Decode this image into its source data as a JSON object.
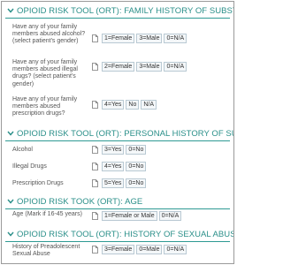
{
  "colors": {
    "accent": "#2a8f89",
    "rule": "#2e9a93",
    "option_border": "#b9c9d3",
    "option_bg": "#f4f7f9"
  },
  "icons": {
    "section_toggle": "chevron-down-icon",
    "field_notes": "document-icon"
  },
  "sections": [
    {
      "title": "OPIOID RISK TOOL (ORT): FAMILY HISTORY OF SUBSTANCE ABUSE",
      "questions": [
        {
          "text": "Have any of your family members abused alcohol? (select patient's gender)",
          "options": [
            "1=Female",
            "3=Male",
            "0=N/A"
          ]
        },
        {
          "text": "Have any of your family members abused illegal drugs? (select patient's gender)",
          "options": [
            "2=Female",
            "3=Male",
            "0=N/A"
          ]
        },
        {
          "text": "Have any of your family members abused prescription drugs?",
          "options": [
            "4=Yes",
            "No",
            "N/A"
          ]
        }
      ]
    },
    {
      "title": "OPIOID RISK TOOL (ORT): PERSONAL HISTORY OF SUBSTANCE ABUSE",
      "questions": [
        {
          "text": "Alcohol",
          "options": [
            "3=Yes",
            "0=No"
          ]
        },
        {
          "text": "Illegal Drugs",
          "options": [
            "4=Yes",
            "0=No"
          ]
        },
        {
          "text": "Prescription Drugs",
          "options": [
            "5=Yes",
            "0=No"
          ]
        }
      ]
    },
    {
      "title": "OPIOID RISK TOOK (ORT): AGE",
      "questions": [
        {
          "text": "Age (Mark if 16-45 years)",
          "options": [
            "1=Female or Male",
            "0=N/A"
          ]
        }
      ]
    },
    {
      "title": "OPIOID RISK TOOL (ORT): HISTORY OF SEXUAL ABUSE",
      "questions": [
        {
          "text": "History of Preadolescent Sexual Abuse",
          "options": [
            "3=Female",
            "0=Male",
            "0=N/A"
          ]
        }
      ]
    }
  ]
}
